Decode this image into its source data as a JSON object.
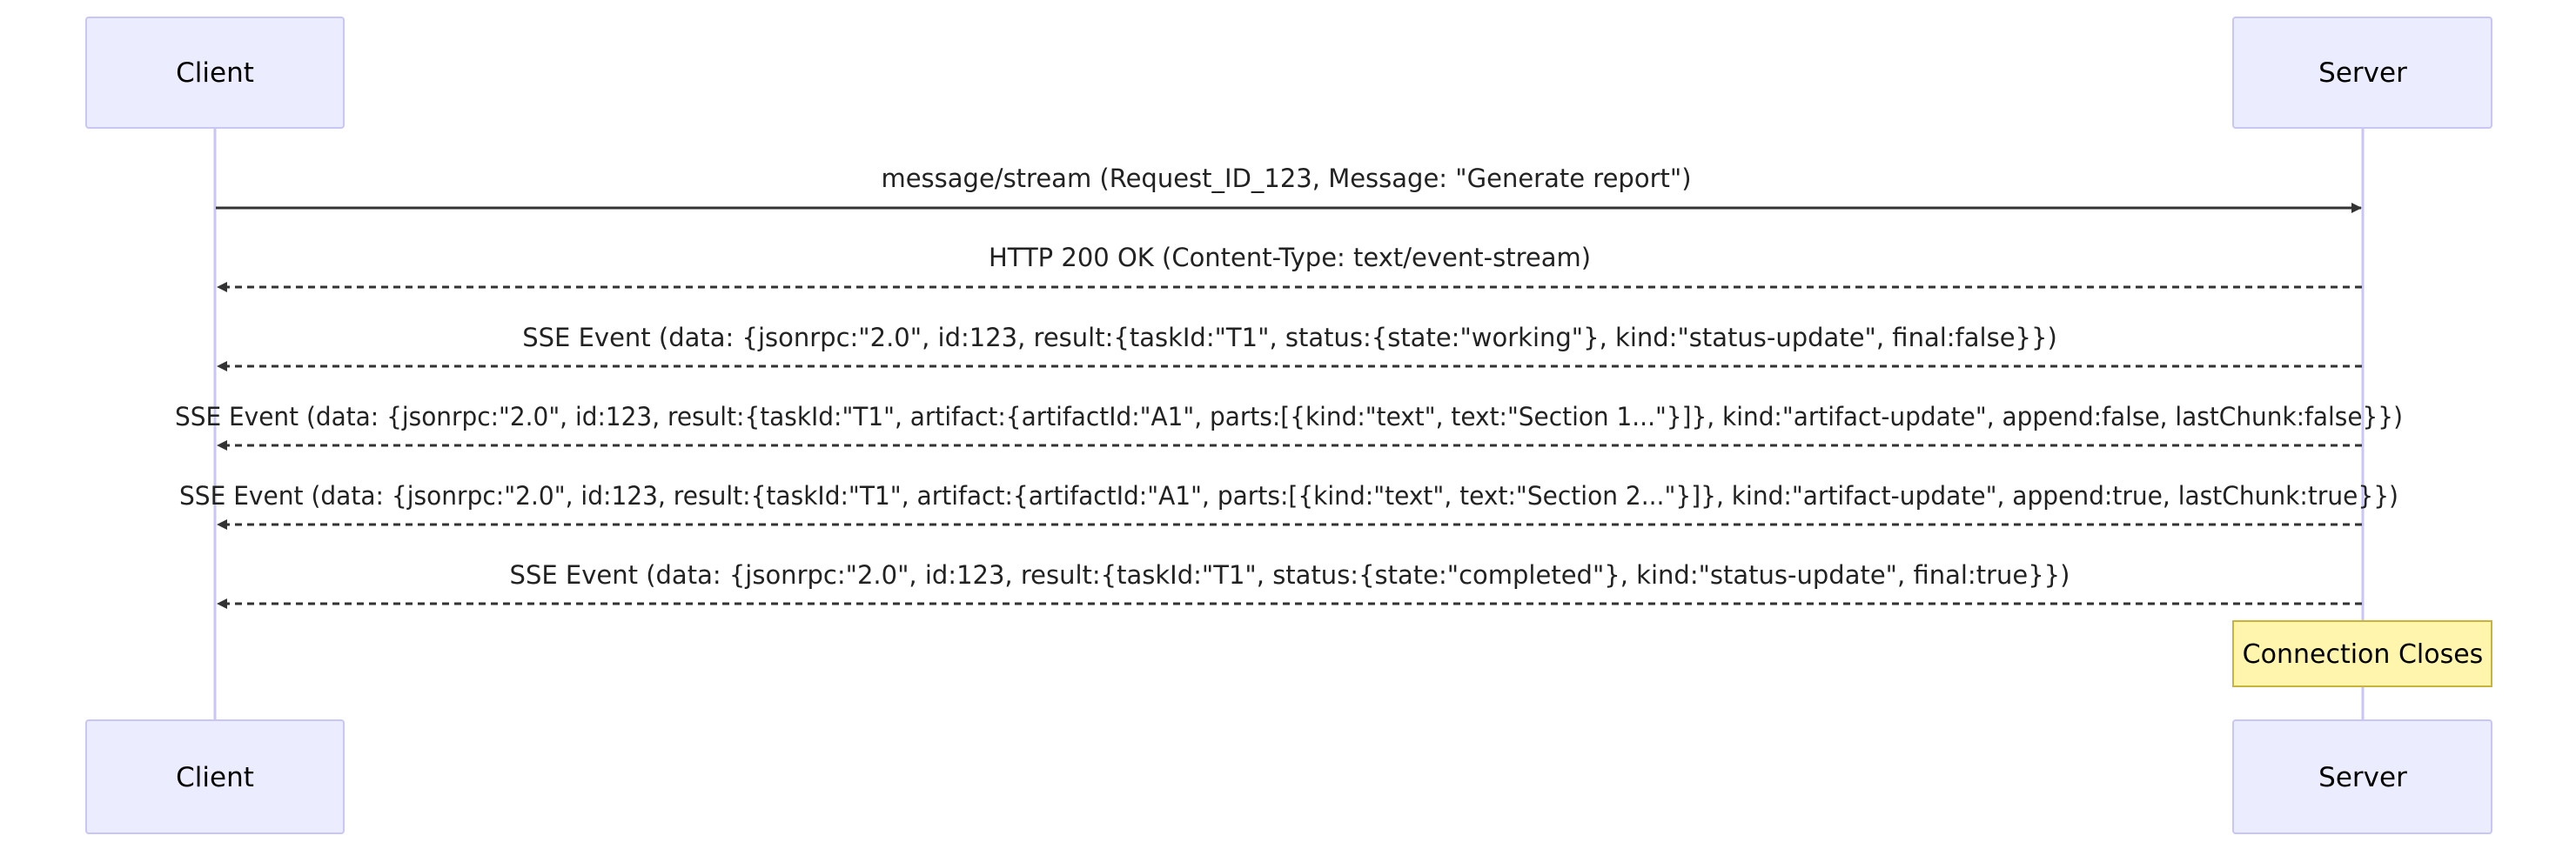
{
  "diagram": {
    "type": "sequence",
    "participants": [
      {
        "id": "client",
        "label": "Client"
      },
      {
        "id": "server",
        "label": "Server"
      }
    ],
    "messages": [
      {
        "from": "client",
        "to": "server",
        "style": "solid",
        "text": "message/stream (Request_ID_123, Message: \"Generate report\")"
      },
      {
        "from": "server",
        "to": "client",
        "style": "dashed",
        "text": "HTTP 200 OK (Content-Type: text/event-stream)"
      },
      {
        "from": "server",
        "to": "client",
        "style": "dashed",
        "text": "SSE Event (data: {jsonrpc:\"2.0\", id:123, result:{taskId:\"T1\", status:{state:\"working\"}, kind:\"status-update\", final:false}})"
      },
      {
        "from": "server",
        "to": "client",
        "style": "dashed",
        "text": "SSE Event (data: {jsonrpc:\"2.0\", id:123, result:{taskId:\"T1\", artifact:{artifactId:\"A1\", parts:[{kind:\"text\", text:\"Section 1...\"}]}, kind:\"artifact-update\", append:false, lastChunk:false}})"
      },
      {
        "from": "server",
        "to": "client",
        "style": "dashed",
        "text": "SSE Event (data: {jsonrpc:\"2.0\", id:123, result:{taskId:\"T1\", artifact:{artifactId:\"A1\", parts:[{kind:\"text\", text:\"Section 2...\"}]}, kind:\"artifact-update\", append:true, lastChunk:true}})"
      },
      {
        "from": "server",
        "to": "client",
        "style": "dashed",
        "text": "SSE Event (data: {jsonrpc:\"2.0\", id:123, result:{taskId:\"T1\", status:{state:\"completed\"}, kind:\"status-update\", final:true}})"
      }
    ],
    "note": {
      "over": "server",
      "text": "Connection Closes"
    },
    "colors": {
      "actor_fill": "#ececff",
      "actor_border": "#c8c6f5",
      "line": "#333333",
      "note_fill": "#fff5ad",
      "note_border": "#c9b43a"
    }
  }
}
